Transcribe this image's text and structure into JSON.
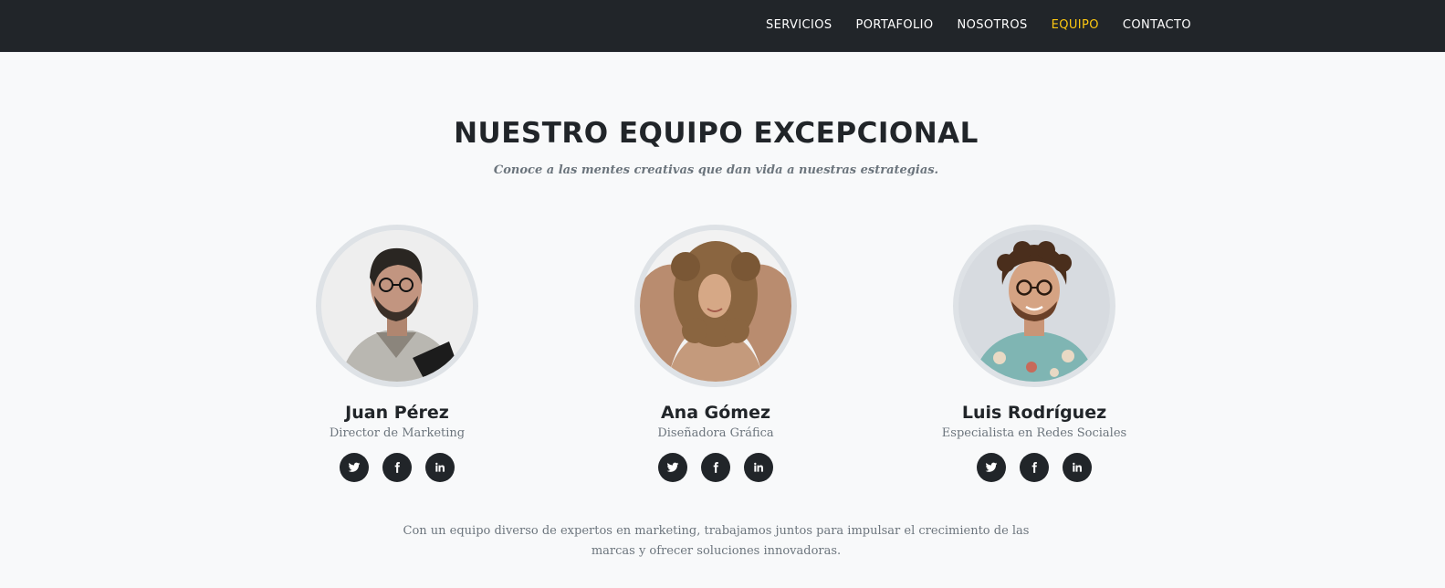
{
  "nav": {
    "items": [
      {
        "label": "SERVICIOS",
        "active": false
      },
      {
        "label": "PORTAFOLIO",
        "active": false
      },
      {
        "label": "NOSOTROS",
        "active": false
      },
      {
        "label": "EQUIPO",
        "active": true
      },
      {
        "label": "CONTACTO",
        "active": false
      }
    ],
    "active_color": "#fec810"
  },
  "team": {
    "heading": "NUESTRO EQUIPO EXCEPCIONAL",
    "subheading": "Conoce a las mentes creativas que dan vida a nuestras estrategias.",
    "members": [
      {
        "name": "Juan Pérez",
        "role": "Director de Marketing",
        "photo": "man-with-glasses-gray-shirt"
      },
      {
        "name": "Ana Gómez",
        "role": "Diseñadora Gráfica",
        "photo": "woman-curly-hair-beige-sweater"
      },
      {
        "name": "Luis Rodríguez",
        "role": "Especialista en Redes Sociales",
        "photo": "man-curly-hair-floral-shirt"
      }
    ],
    "social_icons": [
      "twitter-icon",
      "facebook-icon",
      "linkedin-icon"
    ],
    "closing_text": "Con un equipo diverso de expertos en marketing, trabajamos juntos para impulsar el crecimiento de las marcas y ofrecer soluciones innovadoras."
  },
  "colors": {
    "navbar": "#212529",
    "background": "#f8f9fa",
    "avatar_border": "#dee2e6"
  }
}
